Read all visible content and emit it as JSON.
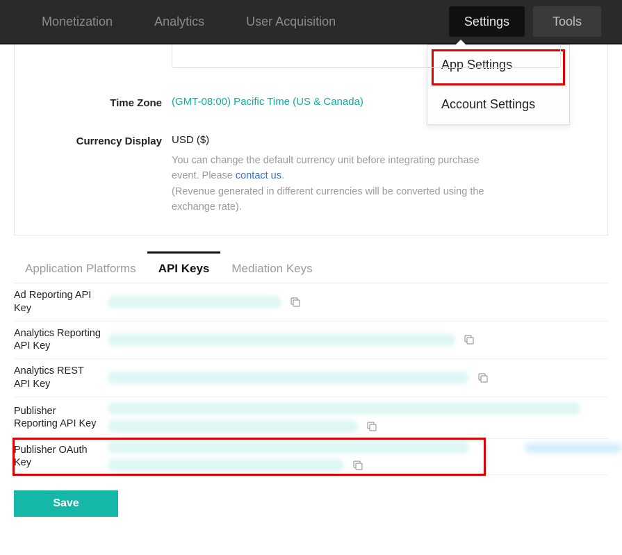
{
  "nav": {
    "monetization": "Monetization",
    "analytics": "Analytics",
    "user_acquisition": "User Acquisition",
    "settings": "Settings",
    "tools": "Tools"
  },
  "dropdown": {
    "app_settings": "App Settings",
    "account_settings": "Account Settings"
  },
  "form": {
    "time_zone_label": "Time Zone",
    "time_zone_value": "(GMT-08:00) Pacific Time (US & Canada)",
    "currency_label": "Currency Display",
    "currency_value": "USD ($)",
    "currency_desc_1": "You can change the default currency unit before integrating purchase event. Please ",
    "contact_us": "contact us",
    "currency_desc_2": ".",
    "currency_desc_3": "(Revenue generated in different currencies will be converted using the exchange rate)."
  },
  "tabs": {
    "platforms": "Application Platforms",
    "api_keys": "API Keys",
    "mediation": "Mediation Keys"
  },
  "keys": [
    {
      "label": "Ad Reporting API Key"
    },
    {
      "label": "Analytics Reporting API Key"
    },
    {
      "label": "Analytics REST API Key"
    },
    {
      "label": "Publisher Reporting API Key"
    },
    {
      "label": "Publisher OAuth Key"
    }
  ],
  "buttons": {
    "save": "Save"
  }
}
